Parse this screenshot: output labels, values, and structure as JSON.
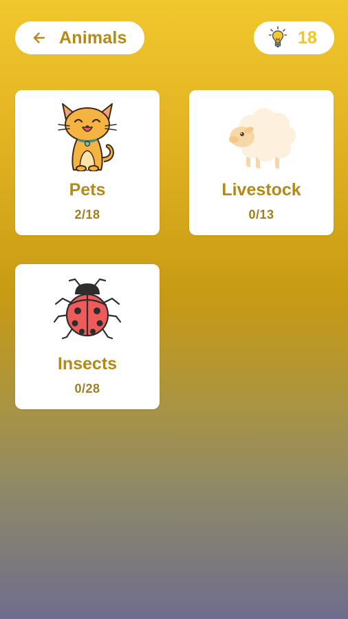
{
  "header": {
    "back_icon": "arrow-left-icon",
    "title": "Animals"
  },
  "hints": {
    "icon": "lightbulb-icon",
    "count": "18"
  },
  "colors": {
    "accent_text": "#b48a14",
    "hint_count": "#f3c51d",
    "bg_top": "#f1c72e",
    "bg_bottom": "#6f6d8d"
  },
  "categories": [
    {
      "name": "Pets",
      "progress": "2/18",
      "icon": "cat-icon"
    },
    {
      "name": "Livestock",
      "progress": "0/13",
      "icon": "sheep-icon"
    },
    {
      "name": "Insects",
      "progress": "0/28",
      "icon": "ladybug-icon"
    }
  ]
}
